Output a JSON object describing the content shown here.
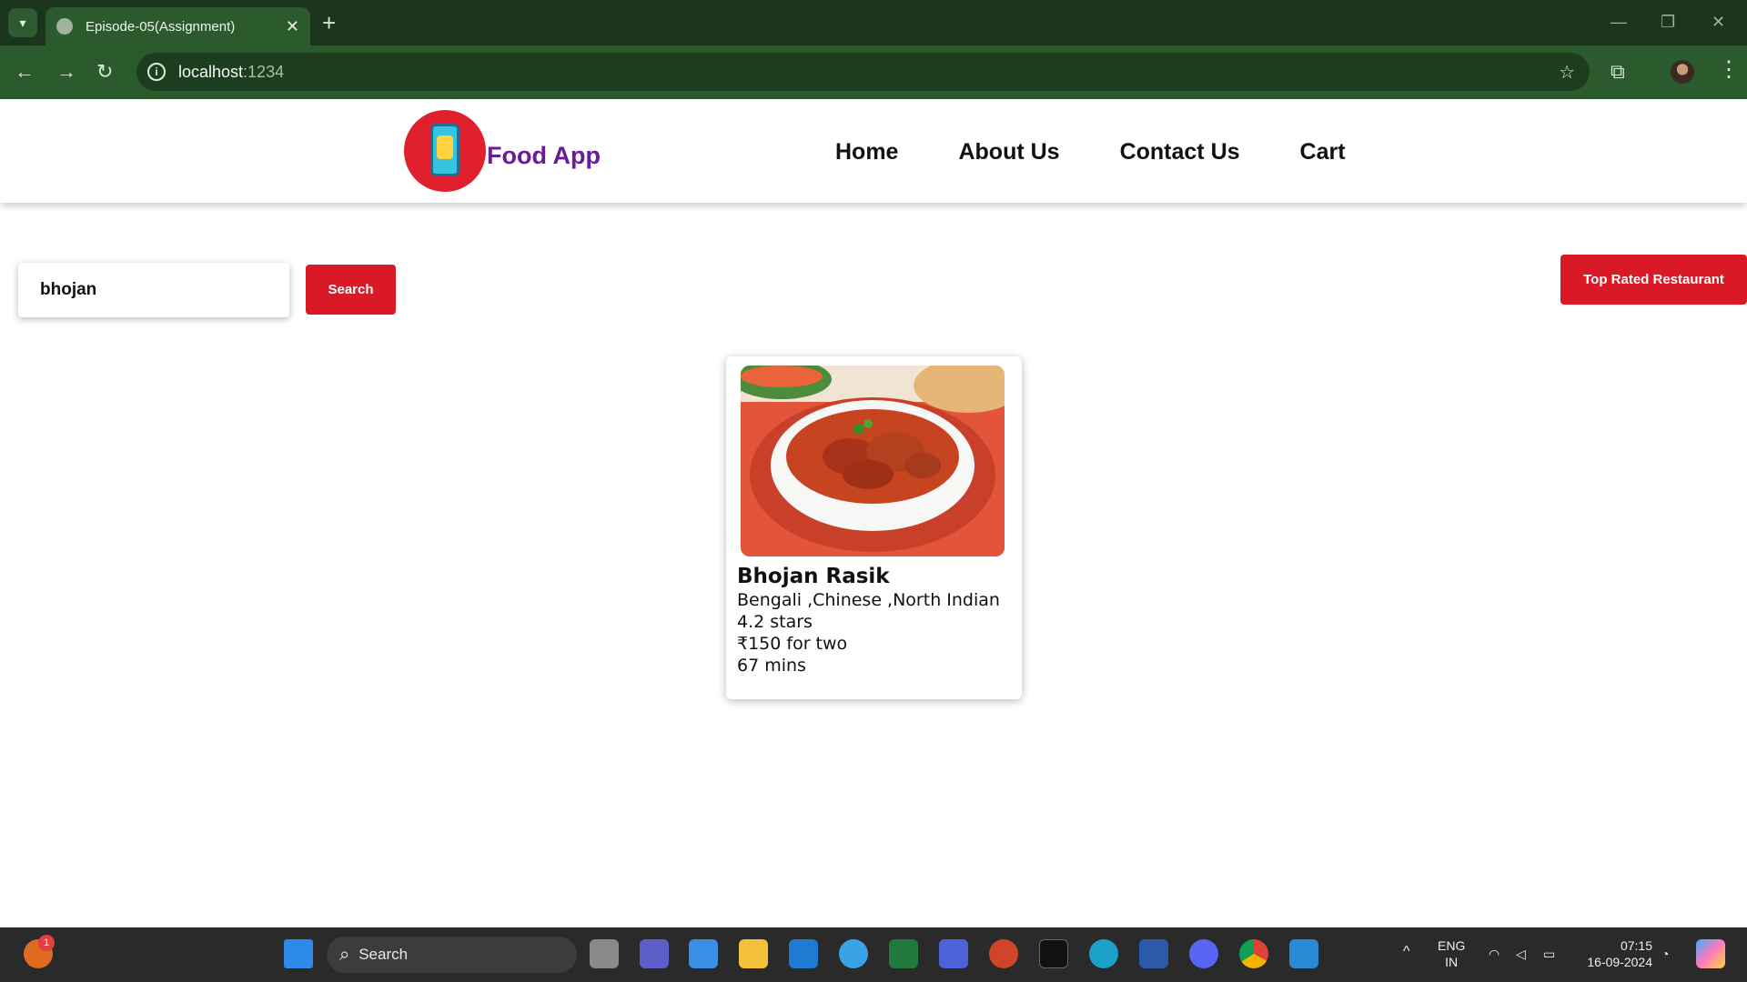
{
  "browser": {
    "tab_title": "Episode-05(Assignment)",
    "url_host": "localhost",
    "url_port": ":1234"
  },
  "header": {
    "brand": "Food App",
    "nav": [
      "Home",
      "About Us",
      "Contact Us",
      "Cart"
    ]
  },
  "search": {
    "value": "bhojan",
    "button_label": "Search"
  },
  "filter": {
    "top_rated_label": "Top Rated Restaurant"
  },
  "restaurant_card": {
    "name": "Bhojan Rasik",
    "cuisines": "Bengali ,Chinese ,North Indian",
    "rating": "4.2 stars",
    "cost": "₹150 for two",
    "delivery_time": "67 mins"
  },
  "taskbar": {
    "search_placeholder": "Search",
    "notification_count": "1",
    "language_line1": "ENG",
    "language_line2": "IN",
    "time": "07:15",
    "date": "16-09-2024"
  },
  "colors": {
    "accent_red": "#d91a26",
    "brand_purple": "#6a1b9a",
    "browser_green": "#2b5a2c"
  }
}
